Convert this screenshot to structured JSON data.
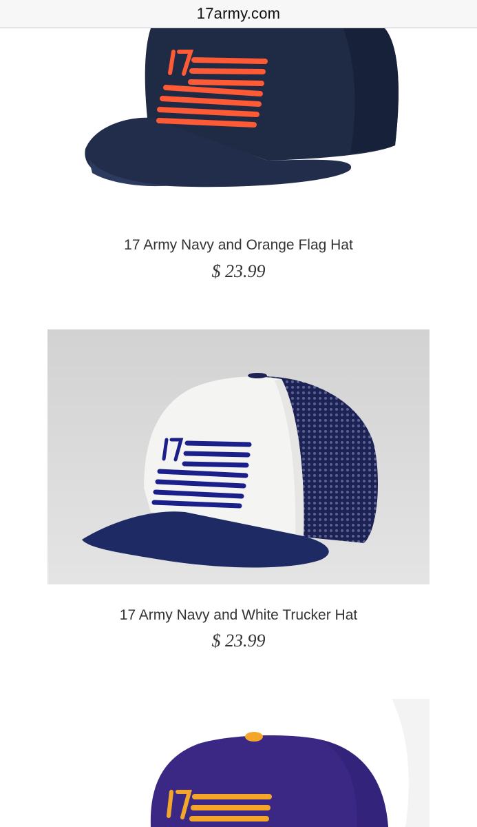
{
  "browser": {
    "url": "17army.com"
  },
  "products": [
    {
      "name": "17 Army Navy and Orange Flag Hat",
      "price": "$ 23.99",
      "image_icon": "navy-orange-flag-snapback-hat",
      "colors": {
        "cap": "#1f2a44",
        "logo": "#ff5a36"
      }
    },
    {
      "name": "17 Army Navy and White Trucker Hat",
      "price": "$ 23.99",
      "image_icon": "navy-white-trucker-hat",
      "colors": {
        "front": "#f4f4f2",
        "mesh": "#1c2354",
        "brim": "#1d2a63",
        "logo": "#1b1f8a",
        "background": "#dcdcdc"
      }
    },
    {
      "name": "",
      "price": "",
      "image_icon": "purple-gold-flag-hat",
      "colors": {
        "cap": "#3b2884",
        "logo": "#f4a62a",
        "button": "#f4a62a"
      }
    }
  ]
}
